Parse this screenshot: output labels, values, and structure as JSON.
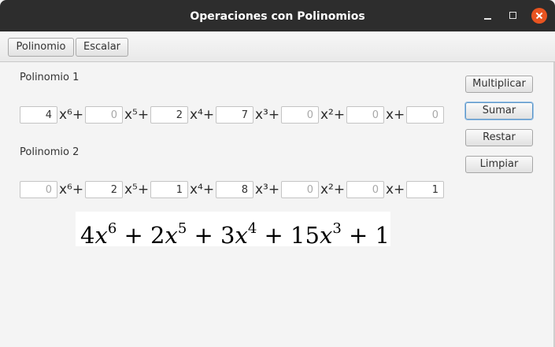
{
  "window": {
    "title": "Operaciones con Polinomios"
  },
  "toolbar": {
    "polinomio_label": "Polinomio",
    "escalar_label": "Escalar"
  },
  "poly1": {
    "label": "Polinomio 1",
    "coefficients": [
      "4",
      "",
      "2",
      "7",
      "",
      "",
      ""
    ],
    "placeholders": [
      "0",
      "0",
      "0",
      "0",
      "0",
      "0",
      "0"
    ]
  },
  "poly2": {
    "label": "Polinomio 2",
    "coefficients": [
      "",
      "2",
      "1",
      "8",
      "",
      "",
      "1"
    ],
    "placeholders": [
      "0",
      "0",
      "0",
      "0",
      "0",
      "0",
      "0"
    ]
  },
  "terms": [
    "x⁶+",
    "x⁵+",
    "x⁴+",
    "x³+",
    "x²+",
    "x+"
  ],
  "actions": {
    "multiplicar": "Multiplicar",
    "sumar": "Sumar",
    "restar": "Restar",
    "limpiar": "Limpiar"
  },
  "result": {
    "terms": [
      {
        "coef": "4",
        "var": "x",
        "exp": "6",
        "sep": " + "
      },
      {
        "coef": "2",
        "var": "x",
        "exp": "5",
        "sep": " + "
      },
      {
        "coef": "3",
        "var": "x",
        "exp": "4",
        "sep": " + "
      },
      {
        "coef": "15",
        "var": "x",
        "exp": "3",
        "sep": " + "
      },
      {
        "coef": "1",
        "var": "",
        "exp": "",
        "sep": ""
      }
    ]
  },
  "icons": {
    "minimize": "minimize-icon",
    "maximize": "maximize-icon",
    "close": "close-icon"
  },
  "colors": {
    "close_button": "#e95420",
    "titlebar": "#2d2d2d",
    "focus_border": "#5a95c8"
  }
}
